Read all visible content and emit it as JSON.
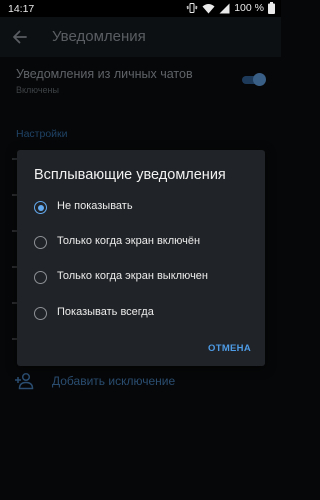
{
  "status_bar": {
    "time": "14:17",
    "battery": "100 %"
  },
  "app_bar": {
    "title": "Уведомления"
  },
  "private_chats": {
    "title": "Уведомления из личных чатов",
    "subtitle": "Включены",
    "enabled": true
  },
  "section": {
    "header": "Настройки"
  },
  "add_exception": {
    "label": "Добавить исключение"
  },
  "dialog": {
    "title": "Всплывающие уведомления",
    "options": [
      {
        "label": "Не показывать",
        "selected": true
      },
      {
        "label": "Только когда экран включён",
        "selected": false
      },
      {
        "label": "Только когда экран выключен",
        "selected": false
      },
      {
        "label": "Показывать всегда",
        "selected": false
      }
    ],
    "cancel_label": "ОТМЕНА"
  },
  "colors": {
    "accent": "#64aaf0",
    "dialog_bg": "#202327",
    "background": "#060708"
  }
}
